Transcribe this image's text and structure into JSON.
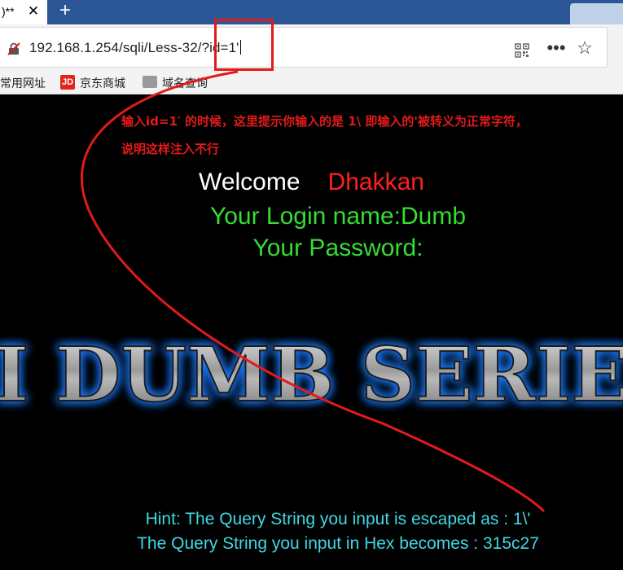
{
  "browser": {
    "tab_title": ")**",
    "url_text": "192.168.1.254/sqli/Less-32/?id=1'",
    "bookmarks": [
      "常用网址",
      "京东商城",
      "域名查询"
    ],
    "jd_badge": "JD",
    "icons": {
      "insecure": "insecure-lock-icon",
      "qr": "qr-code-icon",
      "more": "more-icon",
      "star": "star-icon",
      "close": "close-icon",
      "new_tab": "plus-icon"
    },
    "accent_color": "#2b5797"
  },
  "annotation": {
    "line1": "输入id=1′ 的时候，这里提示你输入的是 1\\ 即输入的'被转义为正常字符，",
    "line2": "说明这样注入不行",
    "color": "#e31a1a"
  },
  "page": {
    "welcome_label": "Welcome",
    "welcome_user": "Dhakkan",
    "login_name": "Your Login name:Dumb",
    "password": "Your Password:",
    "banner_text": "I DUMB SERIE",
    "hint_escaped": "Hint: The Query String you input is escaped as : 1\\'",
    "hint_hex": "The Query String you input in Hex becomes : 315c27"
  }
}
